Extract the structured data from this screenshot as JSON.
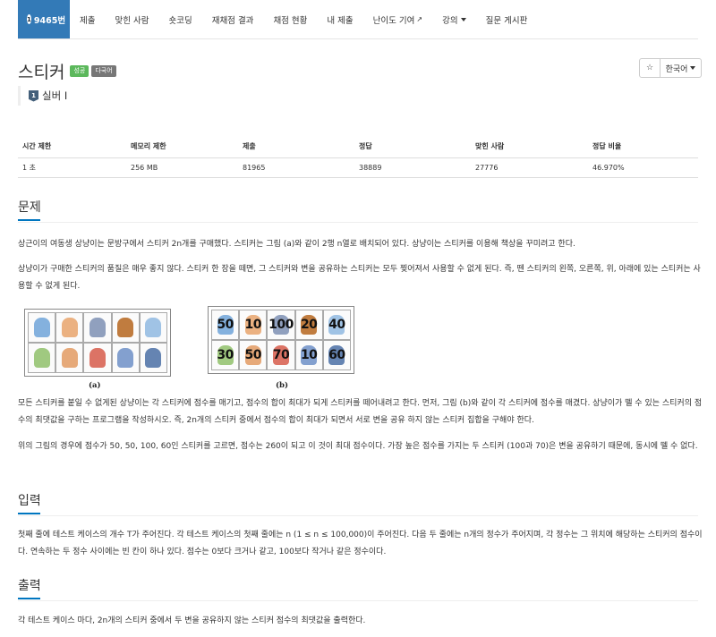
{
  "nav": {
    "problem_id": "9465번",
    "items": [
      "제출",
      "맞힌 사람",
      "숏코딩",
      "재채점 결과",
      "채점 현황",
      "내 제출",
      "난이도 기여",
      "강의",
      "질문 게시판"
    ]
  },
  "problem": {
    "title": "스티커",
    "labels": [
      "성공",
      "다국어"
    ],
    "tier": "실버 I",
    "tier_icon_text": "1",
    "language": "한국어"
  },
  "stats": {
    "headers": [
      "시간 제한",
      "메모리 제한",
      "제출",
      "정답",
      "맞힌 사람",
      "정답 비율"
    ],
    "values": [
      "1 초",
      "256 MB",
      "81965",
      "38889",
      "27776",
      "46.970%"
    ]
  },
  "sections": {
    "problem_title": "문제",
    "problem_p1": "상근이의 여동생 상냥이는 문방구에서 스티커 2n개를 구매했다. 스티커는 그림 (a)와 같이 2행 n열로 배치되어 있다. 상냥이는 스티커를 이용해 책상을 꾸미려고 한다.",
    "problem_p2": "상냥이가 구매한 스티커의 품질은 매우 좋지 않다. 스티커 한 장을 떼면, 그 스티커와 변을 공유하는 스티커는 모두 찢어져서 사용할 수 없게 된다. 즉, 뗀 스티커의 왼쪽, 오른쪽, 위, 아래에 있는 스티커는 사용할 수 없게 된다.",
    "problem_p3": "모든 스티커를 붙일 수 없게된 상냥이는 각 스티커에 점수를 매기고, 점수의 합이 최대가 되게 스티커를 떼어내려고 한다. 먼저, 그림 (b)와 같이 각 스티커에 점수를 매겼다. 상냥이가 뗄 수 있는 스티커의 점수의 최댓값을 구하는 프로그램을 작성하시오. 즉, 2n개의 스티커 중에서 점수의 합이 최대가 되면서 서로 변을 공유 하지 않는 스티커 집합을 구해야 한다.",
    "problem_p4": "위의 그림의 경우에 점수가 50, 50, 100, 60인 스티커를 고르면, 점수는 260이 되고 이 것이 최대 점수이다. 가장 높은 점수를 가지는 두 스티커 (100과 70)은 변을 공유하기 때문에, 동시에 뗄 수 없다.",
    "input_title": "입력",
    "input_p": "첫째 줄에 테스트 케이스의 개수 T가 주어진다. 각 테스트 케이스의 첫째 줄에는 n (1 ≤ n ≤ 100,000)이 주어진다. 다음 두 줄에는 n개의 정수가 주어지며, 각 정수는 그 위치에 해당하는 스티커의 점수이다. 연속하는 두 정수 사이에는 빈 칸이 하나 있다. 점수는 0보다 크거나 같고, 100보다 작거나 같은 정수이다.",
    "output_title": "출력",
    "output_p": "각 테스트 케이스 마다, 2n개의 스티커 중에서 두 변을 공유하지 않는 스티커 점수의 최댓값을 출력한다."
  },
  "figure": {
    "caption_a": "(a)",
    "caption_b": "(b)",
    "scores_top": [
      "50",
      "10",
      "100",
      "20",
      "40"
    ],
    "scores_bottom": [
      "30",
      "50",
      "70",
      "10",
      "60"
    ],
    "sticker_colors": [
      "#6fa3d8",
      "#e8a36b",
      "#7d8fb3",
      "#b5651d",
      "#8fb8e0",
      "#8fbf6a",
      "#e29a62",
      "#d65a4a",
      "#6d8fc7",
      "#4a6fa5"
    ]
  },
  "colors": {
    "accent": "#337ab7",
    "success": "#5cb85c",
    "section_underline": "#0076c0"
  }
}
